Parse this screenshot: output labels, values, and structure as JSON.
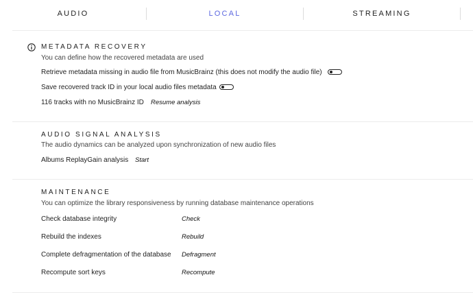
{
  "tabs": [
    {
      "label": "AUDIO",
      "active": false
    },
    {
      "label": "LOCAL",
      "active": true
    },
    {
      "label": "STREAMING",
      "active": false
    }
  ],
  "colors": {
    "accent": "#5b67e0",
    "text": "#222222",
    "separator": "#ececec"
  },
  "metadata_recovery": {
    "icon": "info-icon",
    "title": "METADATA RECOVERY",
    "description": "You can define how the recovered metadata are used",
    "retrieve_label": "Retrieve metadata missing in audio file from MusicBrainz (this does not modify the audio file)",
    "retrieve_enabled": false,
    "save_label": "Save recovered track ID in your local audio files metadata",
    "save_enabled": false,
    "tracks_label": "116 tracks with no MusicBrainz ID",
    "resume_label": "Resume analysis"
  },
  "audio_signal": {
    "title": "AUDIO SIGNAL ANALYSIS",
    "description": "The audio dynamics can be analyzed upon synchronization of new audio files",
    "replaygain_label": "Albums ReplayGain analysis",
    "start_label": "Start"
  },
  "maintenance": {
    "title": "MAINTENANCE",
    "description": "You can optimize the library responsiveness by running database maintenance operations",
    "rows": [
      {
        "label": "Check database integrity",
        "action": "Check"
      },
      {
        "label": "Rebuild the indexes",
        "action": "Rebuild"
      },
      {
        "label": "Complete defragmentation of the database",
        "action": "Defragment"
      },
      {
        "label": "Recompute sort keys",
        "action": "Recompute"
      }
    ]
  }
}
